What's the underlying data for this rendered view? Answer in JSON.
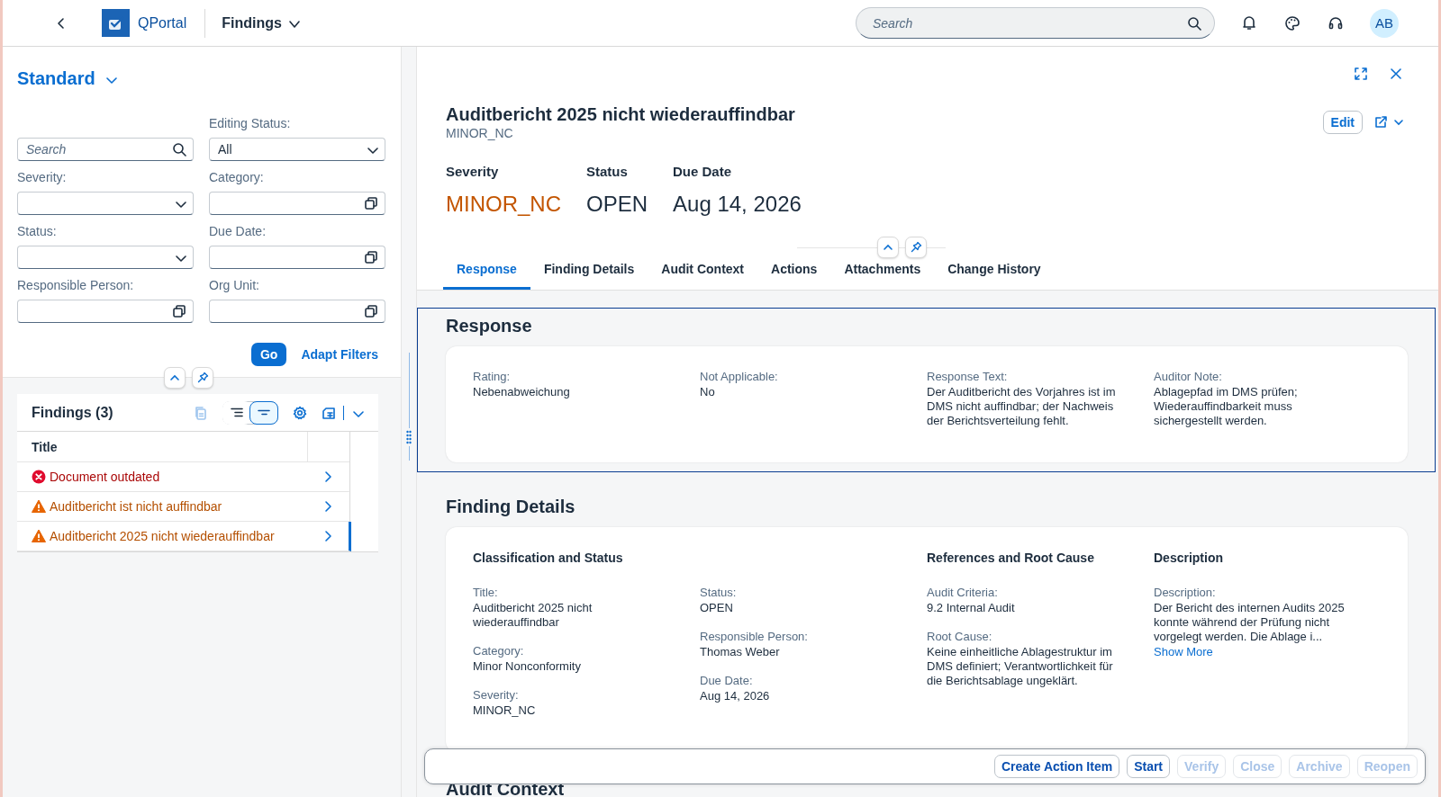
{
  "shell": {
    "app_name": "QPortal",
    "page_title": "Findings",
    "search": {
      "placeholder": "Search"
    },
    "avatar": "AB"
  },
  "filter_bar": {
    "variant": "Standard",
    "filters": [
      {
        "kind": "search",
        "placeholder": "Search"
      },
      {
        "kind": "select",
        "label": "Editing Status:",
        "value": "All"
      },
      {
        "kind": "select",
        "label": "Severity:"
      },
      {
        "kind": "valuehelp",
        "label": "Category:"
      },
      {
        "kind": "select",
        "label": "Status:"
      },
      {
        "kind": "valuehelp",
        "label": "Due Date:"
      },
      {
        "kind": "valuehelp",
        "label": "Responsible Person:"
      },
      {
        "kind": "valuehelp",
        "label": "Org Unit:"
      }
    ],
    "go_button": "Go",
    "adapt_button": "Adapt Filters"
  },
  "list": {
    "title": "Findings (3)",
    "view_toggle": [
      {
        "selected": false
      },
      {
        "selected": true
      }
    ],
    "columns": [
      "Title"
    ],
    "rows": [
      {
        "title": "Document outdated",
        "kind": "error",
        "selected": false
      },
      {
        "title": "Auditbericht ist nicht auffindbar",
        "kind": "warning",
        "selected": false
      },
      {
        "title": "Auditbericht 2025 nicht wiederauffindbar",
        "kind": "warning",
        "selected": true
      }
    ]
  },
  "object": {
    "title": "Auditbericht 2025 nicht wiederauffindbar",
    "subtitle": "MINOR_NC",
    "edit_button": "Edit",
    "attributes": [
      {
        "label": "Severity",
        "value": "MINOR_NC",
        "kind": "warning"
      },
      {
        "label": "Status",
        "value": "OPEN",
        "kind": "plain"
      },
      {
        "label": "Due Date",
        "value": "Aug 14, 2026",
        "kind": "plain"
      }
    ],
    "tabs": [
      {
        "label": "Response",
        "selected": true
      },
      {
        "label": "Finding Details",
        "selected": false
      },
      {
        "label": "Audit Context",
        "selected": false
      },
      {
        "label": "Actions",
        "selected": false
      },
      {
        "label": "Attachments",
        "selected": false
      },
      {
        "label": "Change History",
        "selected": false
      }
    ],
    "sections": [
      {
        "title": "Response",
        "highlighted": true,
        "groups": [
          {
            "fields": [
              {
                "label": "Rating:",
                "value": "Nebenabweichung"
              }
            ]
          },
          {
            "fields": [
              {
                "label": "Not Applicable:",
                "value": "No"
              }
            ]
          },
          {
            "fields": [
              {
                "label": "Response Text:",
                "value": "Der Auditbericht des Vorjahres ist im DMS nicht auffindbar; der Nachweis der Berichtsverteilung fehlt."
              }
            ]
          },
          {
            "fields": [
              {
                "label": "Auditor Note:",
                "value": "Ablagepfad im DMS prüfen; Wiederauffindbarkeit muss sichergestellt werden."
              }
            ]
          }
        ]
      },
      {
        "title": "Finding Details",
        "highlighted": false,
        "groups": [
          {
            "title": "Classification and Status",
            "fields": [
              {
                "label": "Title:",
                "value": "Auditbericht 2025 nicht wiederauffindbar"
              },
              {
                "label": "Category:",
                "value": "Minor Nonconformity"
              },
              {
                "label": "Severity:",
                "value": "MINOR_NC"
              }
            ]
          },
          {
            "fields": [
              {
                "label": "Status:",
                "value": "OPEN"
              },
              {
                "label": "Responsible Person:",
                "value": "Thomas Weber"
              },
              {
                "label": "Due Date:",
                "value": "Aug 14, 2026"
              }
            ]
          },
          {
            "title": "References and Root Cause",
            "fields": [
              {
                "label": "Audit Criteria:",
                "value": "9.2 Internal Audit"
              },
              {
                "label": "Root Cause:",
                "value": "Keine einheitliche Ablagestruktur im DMS definiert; Verantwortlichkeit für die Berichtsablage ungeklärt."
              }
            ]
          },
          {
            "title": "Description",
            "fields": [
              {
                "label": "Description:",
                "value": "Der Bericht des internen Audits 2025 konnte während der Prüfung nicht vorgelegt werden. Die Ablage i...",
                "link": "Show More"
              }
            ]
          }
        ]
      },
      {
        "title": "Audit Context",
        "highlighted": false
      }
    ]
  },
  "footer": {
    "buttons": [
      {
        "label": "Create Action Item",
        "disabled": false
      },
      {
        "label": "Start",
        "disabled": false
      },
      {
        "label": "Verify",
        "disabled": true
      },
      {
        "label": "Close",
        "disabled": true
      },
      {
        "label": "Archive",
        "disabled": true
      },
      {
        "label": "Reopen",
        "disabled": true
      }
    ]
  }
}
